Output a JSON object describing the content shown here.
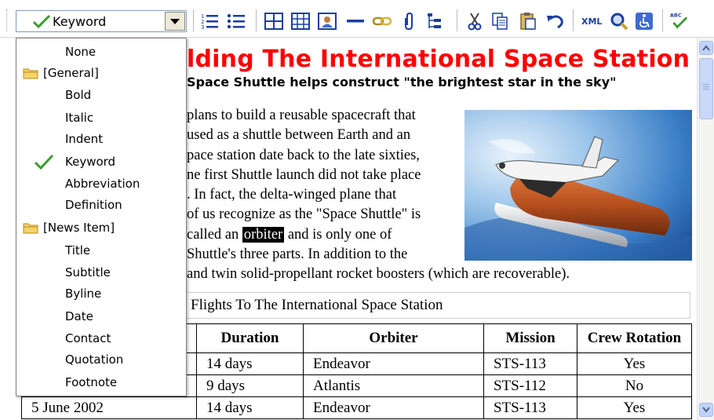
{
  "toolbar": {
    "style_combo_value": "Keyword",
    "icons": [
      "numbered-list-icon",
      "bullet-list-icon",
      "table-icon",
      "table-grid-icon",
      "image-icon",
      "horizontal-rule-icon",
      "link-icon",
      "attachment-icon",
      "tree-icon",
      "cut-icon",
      "copy-icon",
      "paste-icon",
      "undo-icon",
      "xml-icon",
      "find-icon",
      "accessibility-icon",
      "spell-check-icon"
    ],
    "xml_label": "XML",
    "abc_label": "ABC"
  },
  "style_list": {
    "items": [
      {
        "label": "None",
        "kind": "item"
      },
      {
        "label": "[General]",
        "kind": "group"
      },
      {
        "label": "Bold",
        "kind": "item"
      },
      {
        "label": "Italic",
        "kind": "item"
      },
      {
        "label": "Indent",
        "kind": "item"
      },
      {
        "label": "Keyword",
        "kind": "item",
        "selected": true
      },
      {
        "label": "Abbreviation",
        "kind": "item"
      },
      {
        "label": "Definition",
        "kind": "item"
      },
      {
        "label": "[News Item]",
        "kind": "group"
      },
      {
        "label": "Title",
        "kind": "item"
      },
      {
        "label": "Subtitle",
        "kind": "item"
      },
      {
        "label": "Byline",
        "kind": "item"
      },
      {
        "label": "Date",
        "kind": "item"
      },
      {
        "label": "Contact",
        "kind": "item"
      },
      {
        "label": "Quotation",
        "kind": "item"
      },
      {
        "label": "Footnote",
        "kind": "item"
      }
    ]
  },
  "document": {
    "title": "lding The International Space Station",
    "subtitle": "Space Shuttle helps construct \"the brightest star in the sky\"",
    "paragraph_lines": [
      "plans to build a reusable spacecraft that",
      "used as a shuttle between Earth and an",
      "pace station date back to the late sixties,",
      "ne first Shuttle launch did not take place",
      ". In fact, the delta-winged plane that",
      "of us recognize as the \"Space Shuttle\" is",
      "Shuttle's three parts. In addition to the",
      "and twin solid-propellant rocket boosters (which are recoverable)."
    ],
    "line7_before": "called an ",
    "keyword": "orbiter",
    "line7_after": " and is only one of",
    "table_caption": "Flights To The International Space Station",
    "table": {
      "headers": [
        "",
        "Duration",
        "Orbiter",
        "Mission",
        "Crew Rotation"
      ],
      "rows": [
        [
          "",
          "14 days",
          "Endeavor",
          "STS-113",
          "Yes"
        ],
        [
          "",
          "9 days",
          "Atlantis",
          "STS-112",
          "No"
        ],
        [
          "5 June 2002",
          "14 days",
          "Endeavor",
          "STS-113",
          "Yes"
        ]
      ]
    }
  },
  "colors": {
    "title_red": "#ff0000",
    "icon_blue": "#1c3f9e",
    "check_green": "#3a9b2a",
    "folder_yellow": "#f3d36b"
  }
}
